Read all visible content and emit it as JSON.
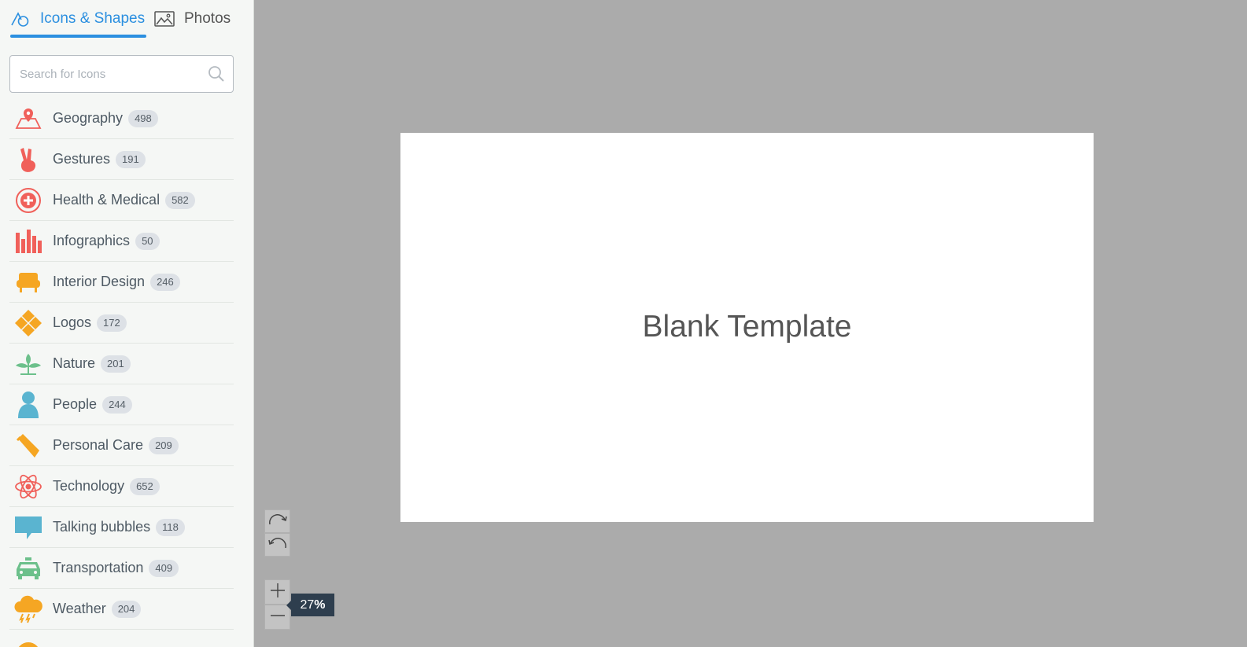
{
  "tabs": {
    "icons_label": "Icons & Shapes",
    "photos_label": "Photos"
  },
  "search": {
    "placeholder": "Search for Icons"
  },
  "categories": [
    {
      "label": "Geography",
      "count": "498",
      "icon": "map-pin-icon",
      "color": "#f0605a"
    },
    {
      "label": "Gestures",
      "count": "191",
      "icon": "peace-hand-icon",
      "color": "#f0605a"
    },
    {
      "label": "Health & Medical",
      "count": "582",
      "icon": "medical-cross-icon",
      "color": "#f0605a"
    },
    {
      "label": "Infographics",
      "count": "50",
      "icon": "bar-chart-icon",
      "color": "#f0605a"
    },
    {
      "label": "Interior Design",
      "count": "246",
      "icon": "armchair-icon",
      "color": "#f5a623"
    },
    {
      "label": "Logos",
      "count": "172",
      "icon": "diamond-logo-icon",
      "color": "#f5a623"
    },
    {
      "label": "Nature",
      "count": "201",
      "icon": "plant-icon",
      "color": "#6cc08b"
    },
    {
      "label": "People",
      "count": "244",
      "icon": "person-icon",
      "color": "#5ab4d0"
    },
    {
      "label": "Personal Care",
      "count": "209",
      "icon": "tube-icon",
      "color": "#f5a623"
    },
    {
      "label": "Technology",
      "count": "652",
      "icon": "atom-icon",
      "color": "#f0605a"
    },
    {
      "label": "Talking bubbles",
      "count": "118",
      "icon": "speech-bubble-icon",
      "color": "#5ab4d0"
    },
    {
      "label": "Transportation",
      "count": "409",
      "icon": "taxi-icon",
      "color": "#6cc08b"
    },
    {
      "label": "Weather",
      "count": "204",
      "icon": "storm-cloud-icon",
      "color": "#f5a623"
    }
  ],
  "canvas": {
    "slide_title": "Blank Template"
  },
  "zoom": {
    "value": "27",
    "unit": "%"
  },
  "colors": {
    "accent": "#2b8fe0",
    "canvas_bg": "#ababab",
    "zoom_bg": "#2e3e4e"
  }
}
